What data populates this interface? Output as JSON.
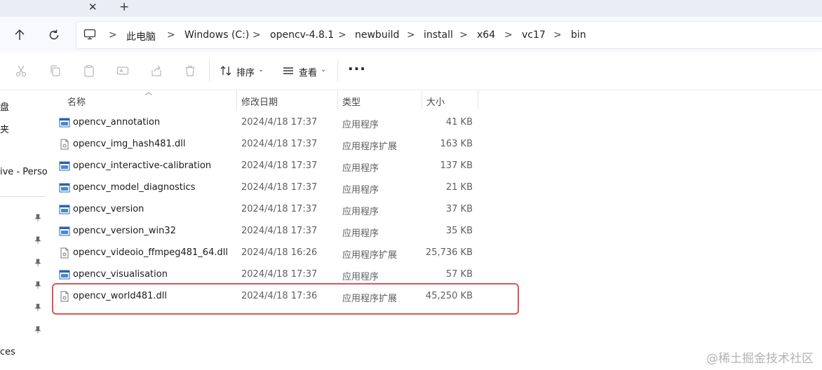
{
  "tabbar": {
    "close_glyph": "✕",
    "new_tab_glyph": "+"
  },
  "address": {
    "crumbs": [
      "此电脑",
      "Windows (C:)",
      "opencv-4.8.1",
      "newbuild",
      "install",
      "x64",
      "vc17",
      "bin"
    ],
    "separator": ">"
  },
  "toolbar": {
    "icons": [
      "cut-icon",
      "copy-icon",
      "paste-icon",
      "rename-icon",
      "share-icon",
      "delete-icon"
    ],
    "sort_label": "排序",
    "view_label": "查看",
    "more_label": "···"
  },
  "nav": {
    "items": [
      "盘",
      "夹",
      "ive - Perso",
      "ces"
    ],
    "pins": 6
  },
  "columns": {
    "name": "名称",
    "date": "修改日期",
    "type": "类型",
    "size": "大小"
  },
  "files": [
    {
      "name": "opencv_annotation",
      "date": "2024/4/18 17:37",
      "type": "应用程序",
      "size": "41 KB",
      "icon": "exe"
    },
    {
      "name": "opencv_img_hash481.dll",
      "date": "2024/4/18 17:37",
      "type": "应用程序扩展",
      "size": "163 KB",
      "icon": "dll"
    },
    {
      "name": "opencv_interactive-calibration",
      "date": "2024/4/18 17:37",
      "type": "应用程序",
      "size": "137 KB",
      "icon": "exe"
    },
    {
      "name": "opencv_model_diagnostics",
      "date": "2024/4/18 17:37",
      "type": "应用程序",
      "size": "21 KB",
      "icon": "exe"
    },
    {
      "name": "opencv_version",
      "date": "2024/4/18 17:37",
      "type": "应用程序",
      "size": "37 KB",
      "icon": "exe"
    },
    {
      "name": "opencv_version_win32",
      "date": "2024/4/18 17:37",
      "type": "应用程序",
      "size": "35 KB",
      "icon": "exe"
    },
    {
      "name": "opencv_videoio_ffmpeg481_64.dll",
      "date": "2024/4/18 16:26",
      "type": "应用程序扩展",
      "size": "25,736 KB",
      "icon": "dll"
    },
    {
      "name": "opencv_visualisation",
      "date": "2024/4/18 17:37",
      "type": "应用程序",
      "size": "57 KB",
      "icon": "exe"
    },
    {
      "name": "opencv_world481.dll",
      "date": "2024/4/18 17:36",
      "type": "应用程序扩展",
      "size": "45,250 KB",
      "icon": "dll"
    }
  ],
  "highlighted_file": "opencv_world481.dll",
  "colors": {
    "highlight": "#e05555",
    "exe_icon": "#2b63b0",
    "tabstrip": "#e9eef6"
  },
  "watermark": "@稀土掘金技术社区"
}
